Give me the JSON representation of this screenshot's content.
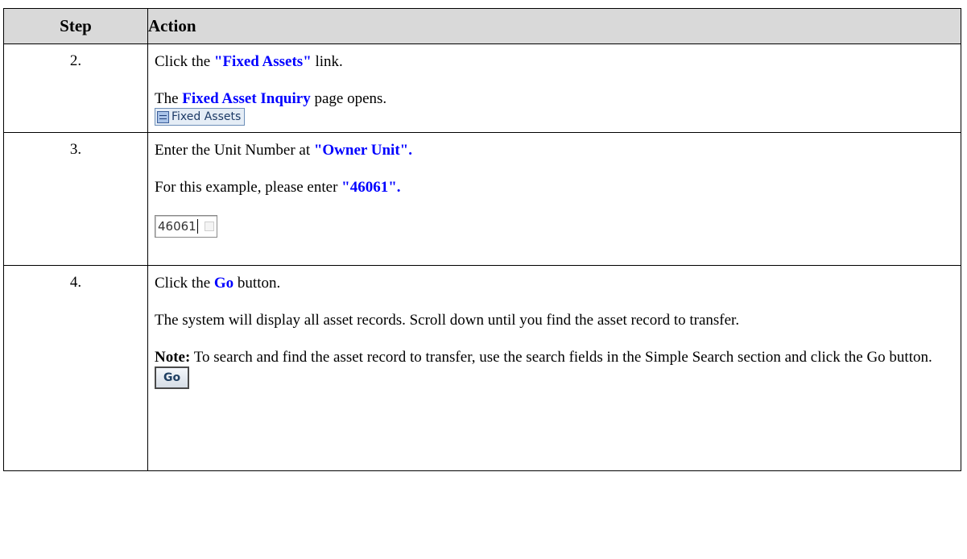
{
  "header": {
    "step": "Step",
    "action": "Action"
  },
  "rows": [
    {
      "num": "2.",
      "line1": {
        "before": "Click the ",
        "kw": "\"Fixed Assets\"",
        "after": " link."
      },
      "line2": {
        "before": "The ",
        "kw": "Fixed Asset Inquiry",
        "after": " page opens."
      },
      "widget_label": "Fixed Assets"
    },
    {
      "num": "3.",
      "line1": {
        "before": "Enter the Unit Number at ",
        "kw": "\"Owner Unit\"."
      },
      "line2": {
        "before": "For this example, please enter ",
        "kw": "\"46061\"."
      },
      "input_value": "46061"
    },
    {
      "num": "4.",
      "line1": {
        "before": "Click the ",
        "kw": "Go",
        "after": " button."
      },
      "para2": "The system will display all asset records. Scroll down until you find the asset record to transfer.",
      "note_label": "Note:",
      "note_text": " To search and find the asset record to transfer, use the search fields in the Simple Search section and click the Go button.",
      "button_label": "Go"
    }
  ],
  "colors": {
    "keyword": "#0000ff",
    "header_bg": "#d9d9d9"
  },
  "icons": {
    "fixed_assets": "list-icon",
    "lookup": "lookup-icon"
  }
}
